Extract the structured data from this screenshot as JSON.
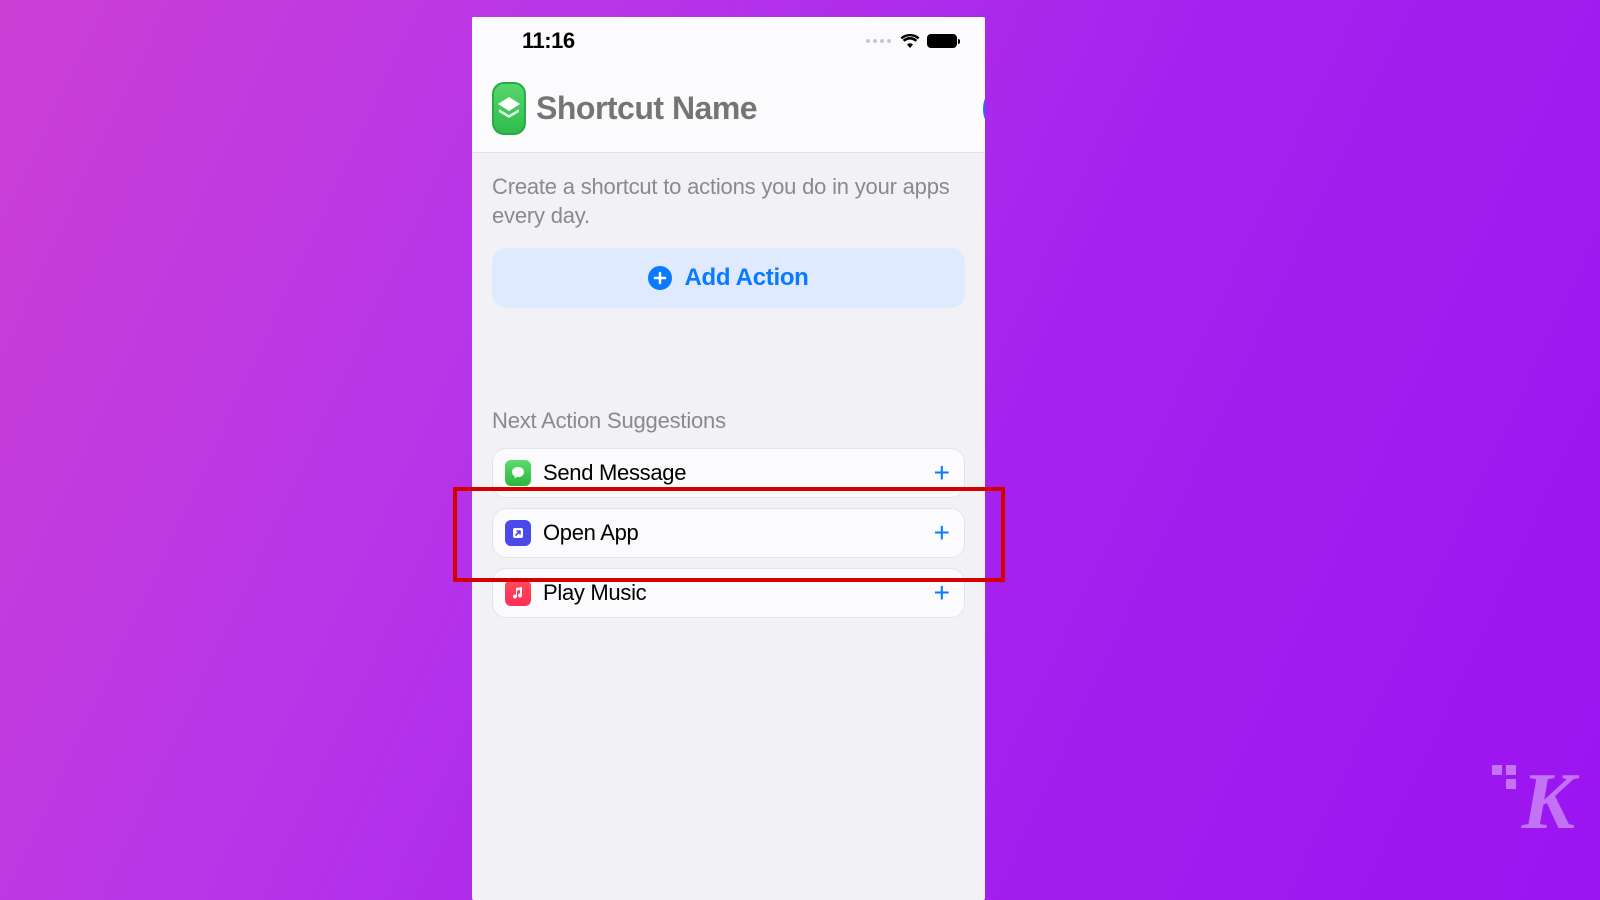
{
  "statusBar": {
    "time": "11:16"
  },
  "header": {
    "titlePlaceholder": "Shortcut Name"
  },
  "content": {
    "description": "Create a shortcut to actions you do in your apps every day.",
    "addActionLabel": "Add Action"
  },
  "suggestions": {
    "title": "Next Action Suggestions",
    "items": [
      {
        "label": "Send Message",
        "iconName": "messages-icon"
      },
      {
        "label": "Open App",
        "iconName": "open-app-icon"
      },
      {
        "label": "Play Music",
        "iconName": "music-icon"
      }
    ]
  },
  "watermark": "K"
}
